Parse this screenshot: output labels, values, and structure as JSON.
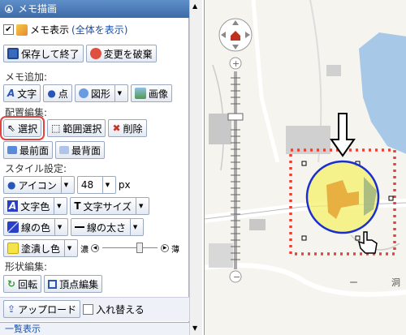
{
  "panel": {
    "title": "メモ描画",
    "show_memo_label": "メモ表示",
    "show_all_link": "(全体を表示)",
    "save_exit": "保存して終了",
    "discard": "変更を破棄",
    "add_section": "メモ追加:",
    "add_text": "文字",
    "add_point": "点",
    "add_shape": "図形",
    "add_image": "画像",
    "arrange_section": "配置編集:",
    "select": "選択",
    "range_select": "範囲選択",
    "delete": "削除",
    "front": "最前面",
    "back": "最背面",
    "style_section": "スタイル設定:",
    "icon_label": "アイコン",
    "size_value": "48",
    "size_unit": "px",
    "text_color": "文字色",
    "text_size": "文字サイズ",
    "line_color": "線の色",
    "line_width": "線の太さ",
    "fill_color": "塗潰し色",
    "dark_label": "濃",
    "light_label": "薄",
    "shape_section": "形状編集:",
    "rotate": "回転",
    "vertex_edit": "頂点編集",
    "upload": "アップロード",
    "replace_label": "入れ替える",
    "list_display": "一覧表示"
  },
  "map": {
    "label_1": "ー",
    "label_2": "洞"
  },
  "colors": {
    "header": "#4a78b6",
    "selection_border": "#e8403a",
    "circle_stroke": "#1a2fd0",
    "circle_fill": "#f4f06a",
    "water": "#a8c8e8"
  }
}
